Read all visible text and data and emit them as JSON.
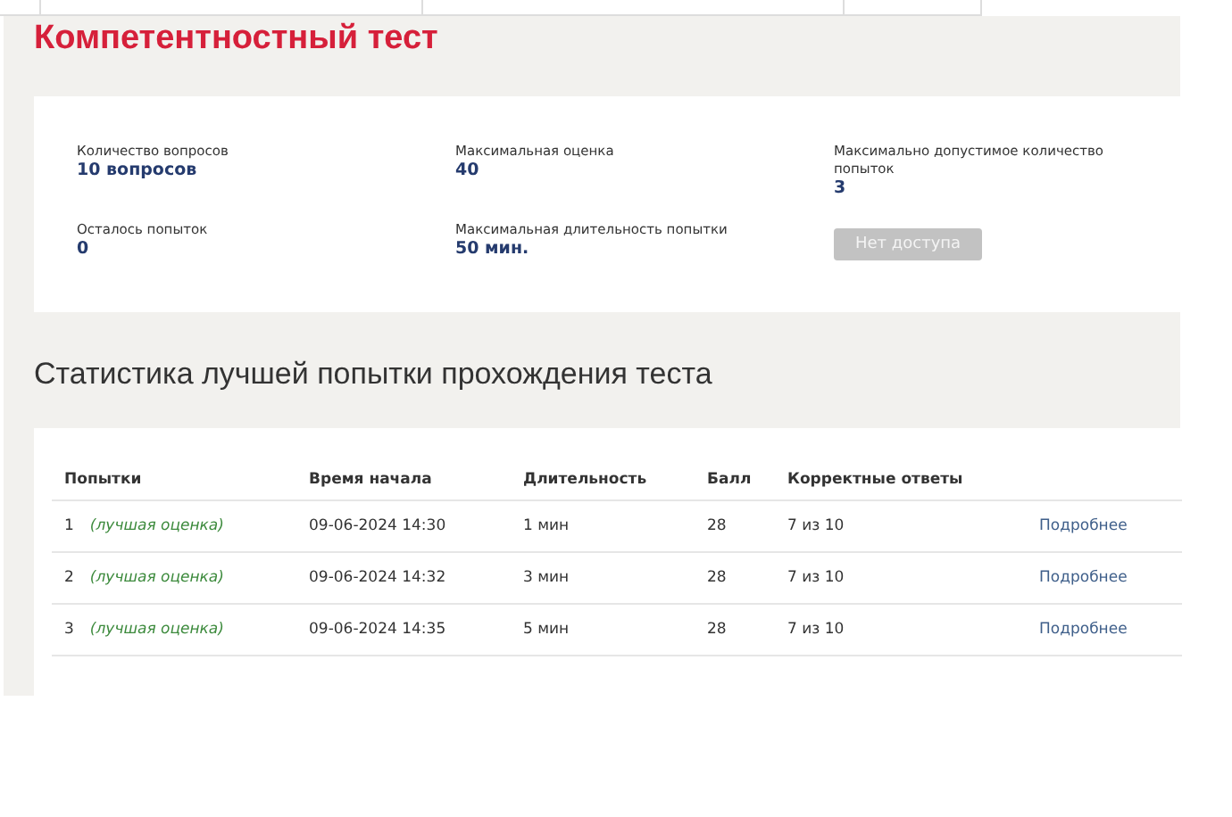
{
  "title": "Компетентностный тест",
  "info": [
    {
      "label": "Количество вопросов",
      "value": "10 вопросов"
    },
    {
      "label": "Максимальная оценка",
      "value": "40"
    },
    {
      "label": "Максимально допустимое количество попыток",
      "value": "3"
    },
    {
      "label": "Осталось попыток",
      "value": "0"
    },
    {
      "label": "Максимальная длительность попытки",
      "value": "50 мин."
    }
  ],
  "start_button": {
    "label": "Нет доступа",
    "disabled": true
  },
  "stats_heading": "Статистика лучшей попытки прохождения теста",
  "table": {
    "columns": [
      "Попытки",
      "Время начала",
      "Длительность",
      "Балл",
      "Корректные ответы"
    ],
    "rows": [
      {
        "attempt": "1",
        "note": "(лучшая оценка)",
        "start": "09-06-2024 14:30",
        "duration": "1 мин",
        "score": "28",
        "correct": "7 из 10",
        "link": "Подробнее"
      },
      {
        "attempt": "2",
        "note": "(лучшая оценка)",
        "start": "09-06-2024 14:32",
        "duration": "3 мин",
        "score": "28",
        "correct": "7 из 10",
        "link": "Подробнее"
      },
      {
        "attempt": "3",
        "note": "(лучшая оценка)",
        "start": "09-06-2024 14:35",
        "duration": "5 мин",
        "score": "28",
        "correct": "7 из 10",
        "link": "Подробнее"
      }
    ]
  }
}
